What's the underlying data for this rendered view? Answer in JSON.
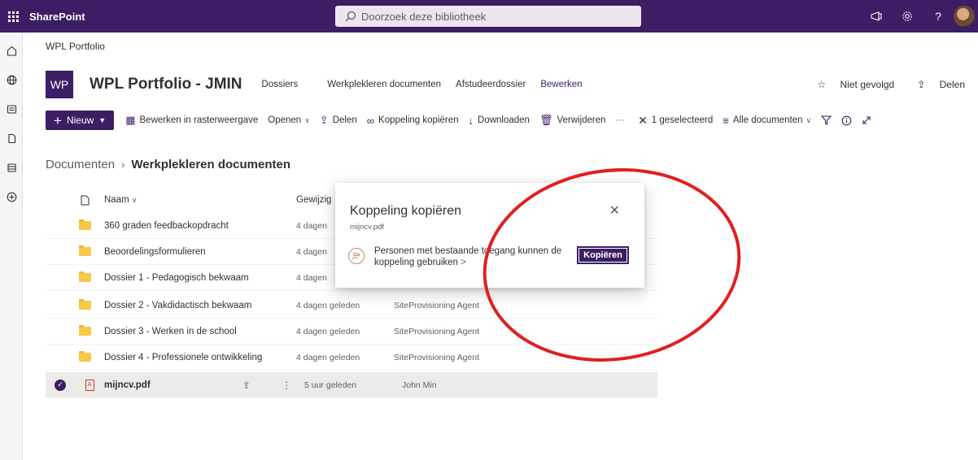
{
  "suitebar": {
    "brand": "SharePoint",
    "search_placeholder": "Doorzoek deze bibliotheek"
  },
  "top_breadcrumb": "WPL Portfolio",
  "site": {
    "logo": "WP",
    "title": "WPL Portfolio - JMIN",
    "nav": [
      "Dossiers",
      "Werkplekleren documenten",
      "Afstudeerdossier",
      "Bewerken"
    ],
    "follow": "Niet gevolgd",
    "share": "Delen"
  },
  "commandbar": {
    "new": "Nieuw",
    "grid_edit": "Bewerken in rasterweergave",
    "open": "Openen",
    "share": "Delen",
    "copy_link": "Koppeling kopiëren",
    "download": "Downloaden",
    "delete": "Verwijderen",
    "more": "···",
    "selected": "1 geselecteerd",
    "view": "Alle documenten"
  },
  "breadcrumb": {
    "root": "Documenten",
    "current": "Werkplekleren documenten"
  },
  "list": {
    "header_name": "Naam",
    "header_modified": "Gewijzig",
    "rows": [
      {
        "name": "360 graden feedbackopdracht",
        "modified": "4 dagen",
        "by": ""
      },
      {
        "name": "Beoordelingsformulieren",
        "modified": "4 dagen",
        "by": ""
      },
      {
        "name": "Dossier 1 - Pedagogisch bekwaam",
        "modified": "4 dagen",
        "by": ""
      },
      {
        "name": "Dossier 2 - Vakdidactisch bekwaam",
        "modified": "4 dagen geleden",
        "by": "SiteProvisioning Agent"
      },
      {
        "name": "Dossier 3 - Werken in de school",
        "modified": "4 dagen geleden",
        "by": "SiteProvisioning Agent"
      },
      {
        "name": "Dossier 4 - Professionele ontwikkeling",
        "modified": "4 dagen geleden",
        "by": "SiteProvisioning Agent"
      }
    ],
    "file": {
      "name": "mijncv.pdf",
      "modified": "5 uur geleden",
      "by": "John Min"
    }
  },
  "dialog": {
    "title": "Koppeling kopiëren",
    "filename": "mijncv.pdf",
    "text": "Personen met bestaande toegang kunnen de koppeling gebruiken",
    "more": ">",
    "copy_button": "Kopiëren"
  },
  "colors": {
    "brand": "#3b1e63",
    "annotation": "#e02020"
  }
}
